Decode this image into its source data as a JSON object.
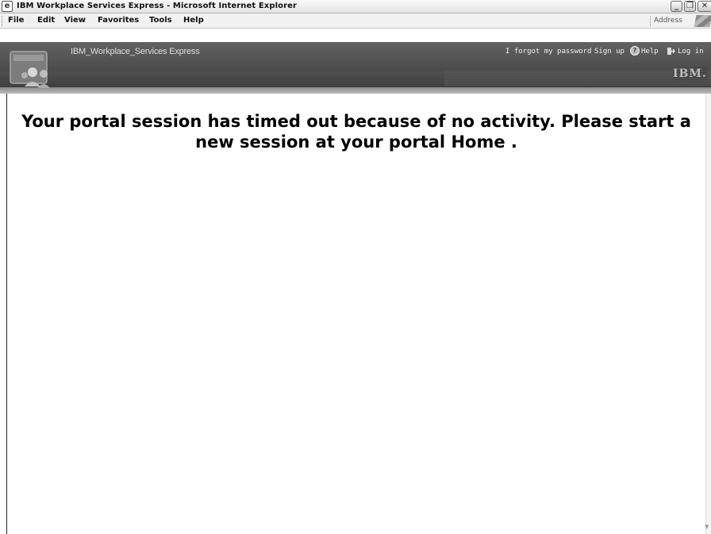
{
  "window": {
    "title": "IBM Workplace Services Express - Microsoft Internet Explorer",
    "controls": {
      "minimize": "_",
      "restore": "❐",
      "close": "✕"
    }
  },
  "menu": {
    "items": [
      "File",
      "Edit",
      "View",
      "Favorites",
      "Tools",
      "Help"
    ],
    "address_label": "Address"
  },
  "banner": {
    "app_name": "IBM_Workplace_Services Express",
    "links": {
      "forgot_password": "I forgot my password",
      "sign_up": "Sign up",
      "help": "Help",
      "log_in": "Log in"
    },
    "brand": "IBM."
  },
  "content": {
    "message": "Your portal session has timed out because of no activity. Please start a new session at your portal Home ."
  },
  "colors": {
    "banner_dark": "#3a3a3a",
    "banner_light": "#626262",
    "text_light": "#f2f2f2"
  },
  "icons": [
    "app-icon",
    "help-icon",
    "login-icon",
    "people-logo-icon",
    "windows-logo-icon"
  ]
}
